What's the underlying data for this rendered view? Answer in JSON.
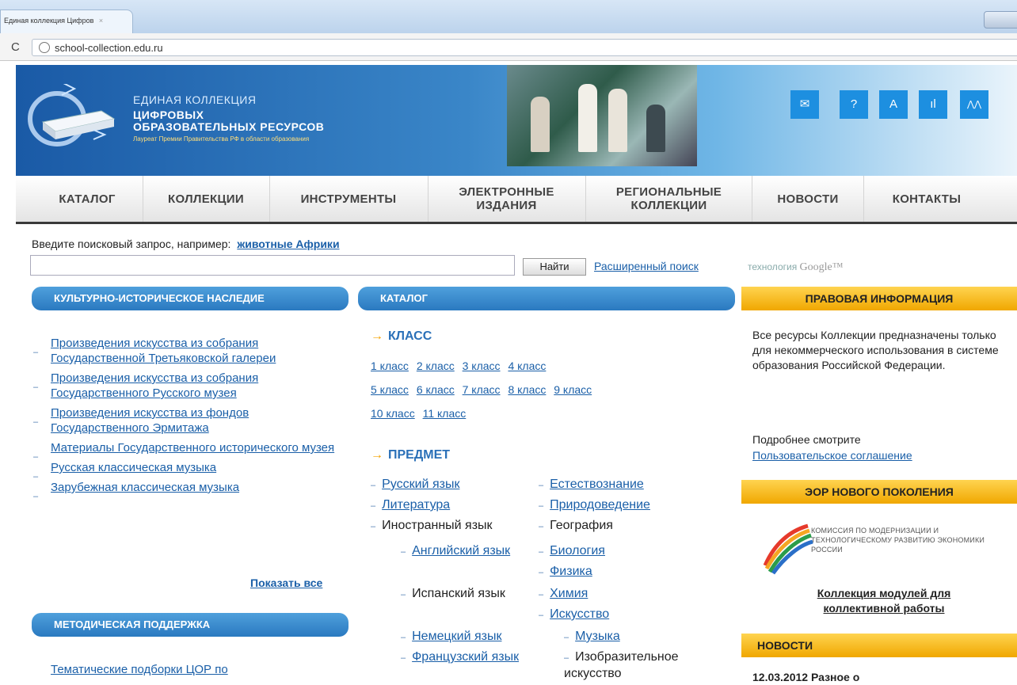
{
  "browser": {
    "tab_title": "Единая коллекция Цифров",
    "tab_close": "×",
    "reload": "C",
    "url": "school-collection.edu.ru"
  },
  "header": {
    "line1": "ЕДИНАЯ КОЛЛЕКЦИЯ",
    "line2": "ЦИФРОВЫХ",
    "line3": "ОБРАЗОВАТЕЛЬНЫХ РЕСУРСОВ",
    "tagline": "Лауреат Премии Правительства РФ в области образования",
    "icons": [
      {
        "name": "mail-icon",
        "glyph": "✉"
      },
      {
        "name": "help-icon",
        "glyph": "?"
      },
      {
        "name": "font-size-icon",
        "glyph": "A"
      },
      {
        "name": "stats-icon",
        "glyph": "ıl"
      },
      {
        "name": "sitemap-icon",
        "glyph": "⋀⋀"
      }
    ]
  },
  "nav": [
    "КАТАЛОГ",
    "КОЛЛЕКЦИИ",
    "ИНСТРУМЕНТЫ",
    "ЭЛЕКТРОННЫЕ ИЗДАНИЯ",
    "РЕГИОНАЛЬНЫЕ КОЛЛЕКЦИИ",
    "НОВОСТИ",
    "КОНТАКТЫ"
  ],
  "search": {
    "hint": "Введите поисковый запрос, например:",
    "example": "животные Африки",
    "button": "Найти",
    "advanced": "Расширенный поиск",
    "tech_prefix": "технология",
    "tech_brand": "Google™"
  },
  "left": {
    "heading": "КУЛЬТУРНО-ИСТОРИЧЕСКОЕ НАСЛЕДИЕ",
    "items": [
      "Произведения искусства из собрания Государственной Третьяковской галереи",
      "Произведения искусства из собрания Государственного Русского музея",
      "Произведения искусства из фондов Государственного Эрмитажа",
      "Материалы Государственного исторического музея",
      "Русская классическая музыка",
      "Зарубежная классическая музыка"
    ],
    "show_all": "Показать все",
    "heading2": "МЕТОДИЧЕСКАЯ ПОДДЕРЖКА",
    "item2": "Тематические подборки ЦОР по"
  },
  "catalog": {
    "heading": "КАТАЛОГ",
    "class_label": "КЛАСС",
    "grades_row1": [
      "1 класс",
      "2 класс",
      "3 класс",
      "4 класс"
    ],
    "grades_row2": [
      "5 класс",
      "6 класс",
      "7 класс",
      "8 класс",
      "9 класс"
    ],
    "grades_row3": [
      "10 класс",
      "11 класс"
    ],
    "subject_label": "ПРЕДМЕТ",
    "subjects_left": [
      "Русский язык",
      "Литература",
      "Иностранный язык"
    ],
    "languages": [
      "Английский язык",
      "Испанский язык",
      "Немецкий язык",
      "Французский язык"
    ],
    "subjects_right": [
      "Естествознание",
      "Природоведение",
      "География",
      "Биология",
      "Физика",
      "Химия",
      "Искусство"
    ],
    "arts": [
      "Музыка",
      "Изобразительное искусство"
    ]
  },
  "right": {
    "legal_heading": "ПРАВОВАЯ ИНФОРМАЦИЯ",
    "legal_text": "Все ресурсы Коллекции предназначены только для некоммерческого использования в системе образования Российской Федерации.",
    "more": "Подробнее смотрите",
    "agreement": "Пользовательское соглашение",
    "eor_heading": "ЭОР НОВОГО ПОКОЛЕНИЯ",
    "eor_logo_text": "КОМИССИЯ ПО МОДЕРНИЗАЦИИ И ТЕХНОЛОГИЧЕСКОМУ РАЗВИТИЮ ЭКОНОМИКИ РОССИИ",
    "modules_link": "Коллекция модулей для коллективной работы",
    "news_heading": "НОВОСТИ",
    "news_item": "12.03.2012  Разное о "
  }
}
